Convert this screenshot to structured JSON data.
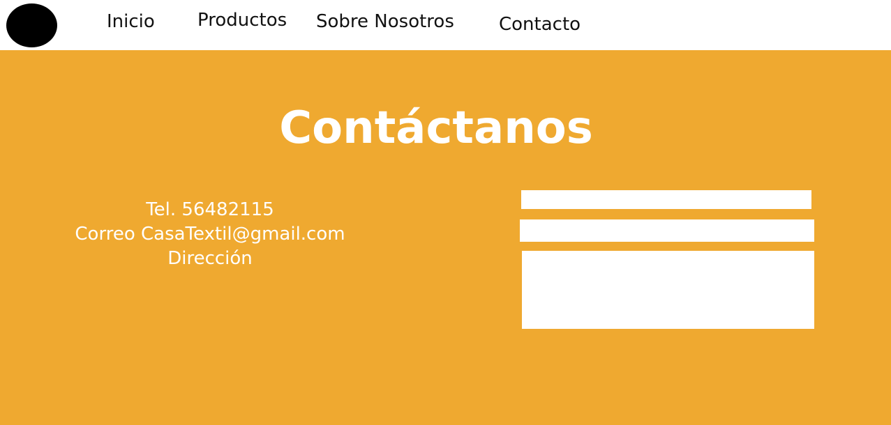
{
  "nav": {
    "logo_icon": "circle-logo-icon",
    "links": [
      "Inicio",
      "Productos",
      "Sobre Nosotros",
      "Contacto"
    ]
  },
  "hero": {
    "title": "Contáctanos",
    "background_color": "#efa930"
  },
  "contact_info": {
    "phone": "Tel. 56482115",
    "email": "Correo CasaTextil@gmail.com",
    "address": "Dirección"
  },
  "form": {
    "name_value": "",
    "email_value": "",
    "message_value": ""
  }
}
